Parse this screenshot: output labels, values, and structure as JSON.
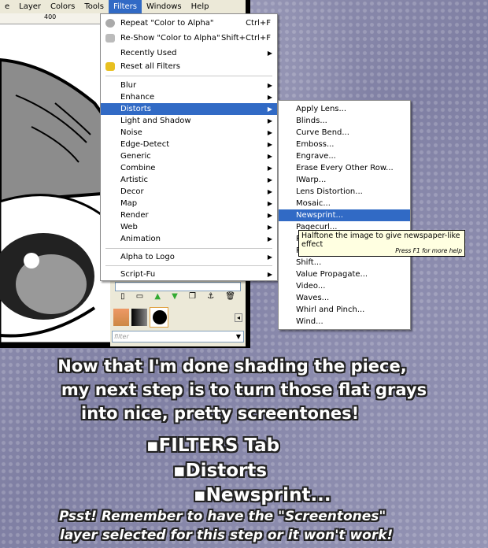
{
  "menubar": {
    "items": [
      "e",
      "Layer",
      "Colors",
      "Tools",
      "Filters",
      "Windows",
      "Help"
    ],
    "active": "Filters"
  },
  "ruler": {
    "label": "400"
  },
  "filters_menu": {
    "top": [
      {
        "label": "Repeat \"Color to Alpha\"",
        "shortcut": "Ctrl+F",
        "icon": "repeat-icon"
      },
      {
        "label": "Re-Show \"Color to Alpha\"",
        "shortcut": "Shift+Ctrl+F",
        "icon": "reshow-icon"
      },
      {
        "label": "Recently Used",
        "submenu": true
      },
      {
        "label": "Reset all Filters",
        "icon": "reset-icon"
      }
    ],
    "categories": [
      "Blur",
      "Enhance",
      "Distorts",
      "Light and Shadow",
      "Noise",
      "Edge-Detect",
      "Generic",
      "Combine",
      "Artistic",
      "Decor",
      "Map",
      "Render",
      "Web",
      "Animation"
    ],
    "selected": "Distorts",
    "alpha_to_logo": "Alpha to Logo",
    "script_fu": "Script-Fu"
  },
  "distorts_menu": {
    "items": [
      "Apply Lens...",
      "Blinds...",
      "Curve Bend...",
      "Emboss...",
      "Engrave...",
      "Erase Every Other Row...",
      "IWarp...",
      "Lens Distortion...",
      "Mosaic...",
      "Newsprint...",
      "Pagecurl...",
      "Polar Coords...",
      "Ripple...",
      "Shift...",
      "Value Propagate...",
      "Video...",
      "Waves...",
      "Whirl and Pinch...",
      "Wind..."
    ],
    "selected": "Newsprint..."
  },
  "tooltip": {
    "text": "Halftone the image to give newspaper-like effect",
    "help": "Press F1 for more help"
  },
  "layers_panel": {
    "filter_placeholder": "filter"
  },
  "caption": {
    "lines": [
      "Now that I'm done shading the piece,",
      "my next step is to turn those flat grays",
      "into nice, pretty screentones!"
    ],
    "steps": [
      "FILTERS Tab",
      "Distorts",
      "Newsprint..."
    ],
    "note": [
      "Psst! Remember to have the \"Screentones\"",
      "layer selected for this step or it won't work!"
    ]
  },
  "colors": {
    "highlight": "#316ac5",
    "menubar": "#ece9d8",
    "tooltip": "#ffffe1"
  }
}
